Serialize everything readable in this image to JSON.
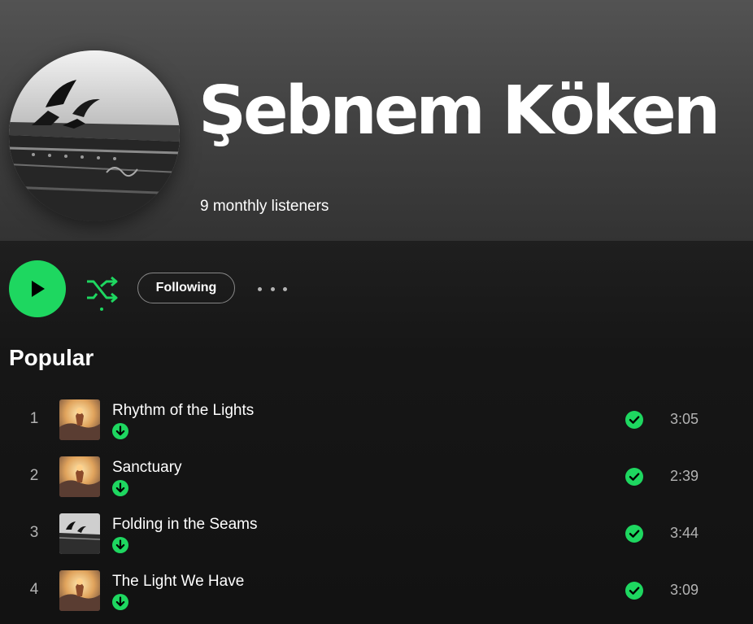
{
  "artist": {
    "name": "Şebnem Köken",
    "monthly_listeners": "9 monthly listeners"
  },
  "actions": {
    "follow_label": "Following"
  },
  "popular": {
    "title": "Popular",
    "tracks": [
      {
        "index": "1",
        "title": "Rhythm of the Lights",
        "duration": "3:05",
        "art": "sunrise-art"
      },
      {
        "index": "2",
        "title": "Sanctuary",
        "duration": "2:39",
        "art": "sunrise-art"
      },
      {
        "index": "3",
        "title": "Folding in the Seams",
        "duration": "3:44",
        "art": "birds-bw-art"
      },
      {
        "index": "4",
        "title": "The Light We Have",
        "duration": "3:09",
        "art": "sunrise-art"
      }
    ]
  },
  "colors": {
    "accent": "#1ed760",
    "background": "#121212",
    "secondary_text": "#b3b3b3"
  }
}
